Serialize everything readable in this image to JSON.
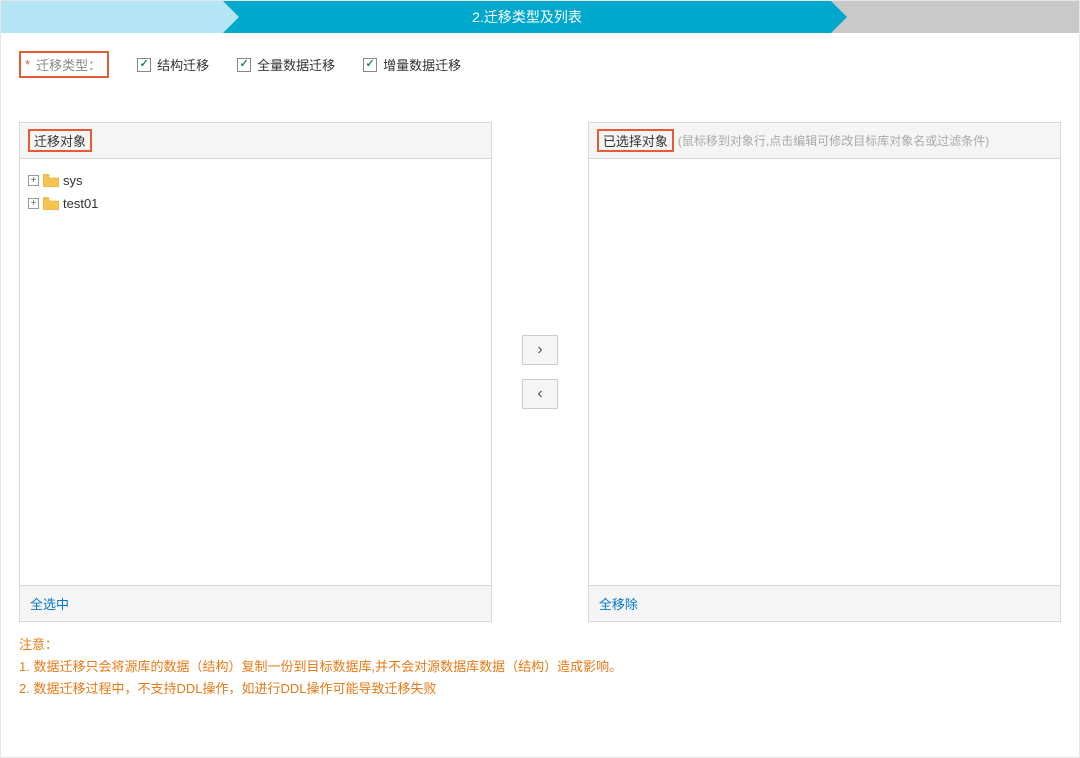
{
  "step": {
    "title": "2.迁移类型及列表"
  },
  "typeRow": {
    "label": "迁移类型：",
    "checkboxes": [
      {
        "label": "结构迁移",
        "checked": true
      },
      {
        "label": "全量数据迁移",
        "checked": true
      },
      {
        "label": "增量数据迁移",
        "checked": true
      }
    ]
  },
  "sourcePanel": {
    "title": "迁移对象",
    "items": [
      {
        "name": "sys"
      },
      {
        "name": "test01"
      }
    ],
    "footerAction": "全选中"
  },
  "targetPanel": {
    "title": "已选择对象",
    "hint": "(鼠标移到对象行,点击编辑可修改目标库对象名或过滤条件)",
    "footerAction": "全移除"
  },
  "notes": {
    "heading": "注意：",
    "lines": [
      "1. 数据迁移只会将源库的数据（结构）复制一份到目标数据库,并不会对源数据库数据（结构）造成影响。",
      "2. 数据迁移过程中，不支持DDL操作，如进行DDL操作可能导致迁移失败"
    ]
  }
}
